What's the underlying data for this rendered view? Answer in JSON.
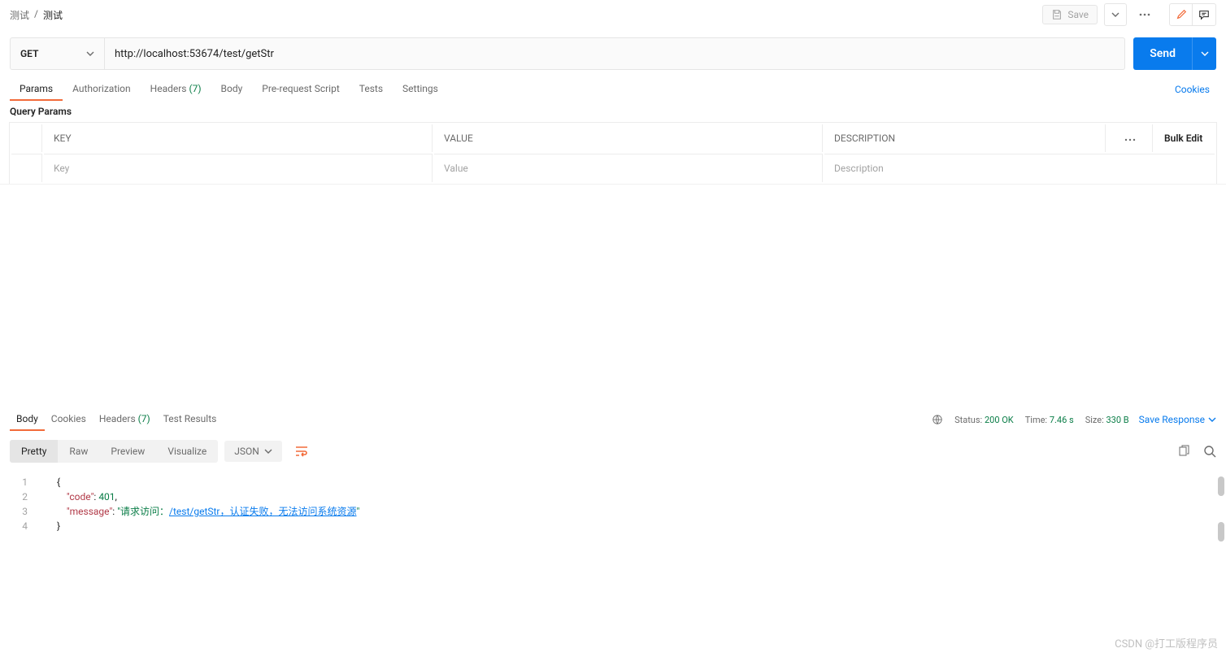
{
  "breadcrumb": {
    "parent": "测试",
    "separator": "/",
    "current": "测试"
  },
  "header": {
    "save": "Save"
  },
  "request": {
    "method": "GET",
    "url": "http://localhost:53674/test/getStr",
    "send": "Send"
  },
  "req_tabs": {
    "params": "Params",
    "authorization": "Authorization",
    "headers": "Headers",
    "headers_count": "(7)",
    "body": "Body",
    "prerequest": "Pre-request Script",
    "tests": "Tests",
    "settings": "Settings",
    "cookies_link": "Cookies"
  },
  "params_section": {
    "title": "Query Params",
    "cols": {
      "key": "KEY",
      "value": "VALUE",
      "desc": "DESCRIPTION",
      "bulk": "Bulk Edit"
    },
    "placeholders": {
      "key": "Key",
      "value": "Value",
      "desc": "Description"
    }
  },
  "resp_tabs": {
    "body": "Body",
    "cookies": "Cookies",
    "headers": "Headers",
    "headers_count": "(7)",
    "test_results": "Test Results"
  },
  "status": {
    "status_label": "Status:",
    "status_value": "200 OK",
    "time_label": "Time:",
    "time_value": "7.46 s",
    "size_label": "Size:",
    "size_value": "330 B",
    "save_response": "Save Response"
  },
  "view_modes": {
    "pretty": "Pretty",
    "raw": "Raw",
    "preview": "Preview",
    "visualize": "Visualize",
    "format": "JSON"
  },
  "json_body": {
    "line1": "{",
    "line2_key": "\"code\"",
    "line2_sep": ": ",
    "line2_val": "401",
    "line2_end": ",",
    "line3_key": "\"message\"",
    "line3_sep": ": ",
    "line3_q": "\"",
    "line3_pre": "请求访问：",
    "line3_link": "/test/getStr，认证失败，无法访问系统资源",
    "line4": "}"
  },
  "watermark": "CSDN @打工版程序员"
}
